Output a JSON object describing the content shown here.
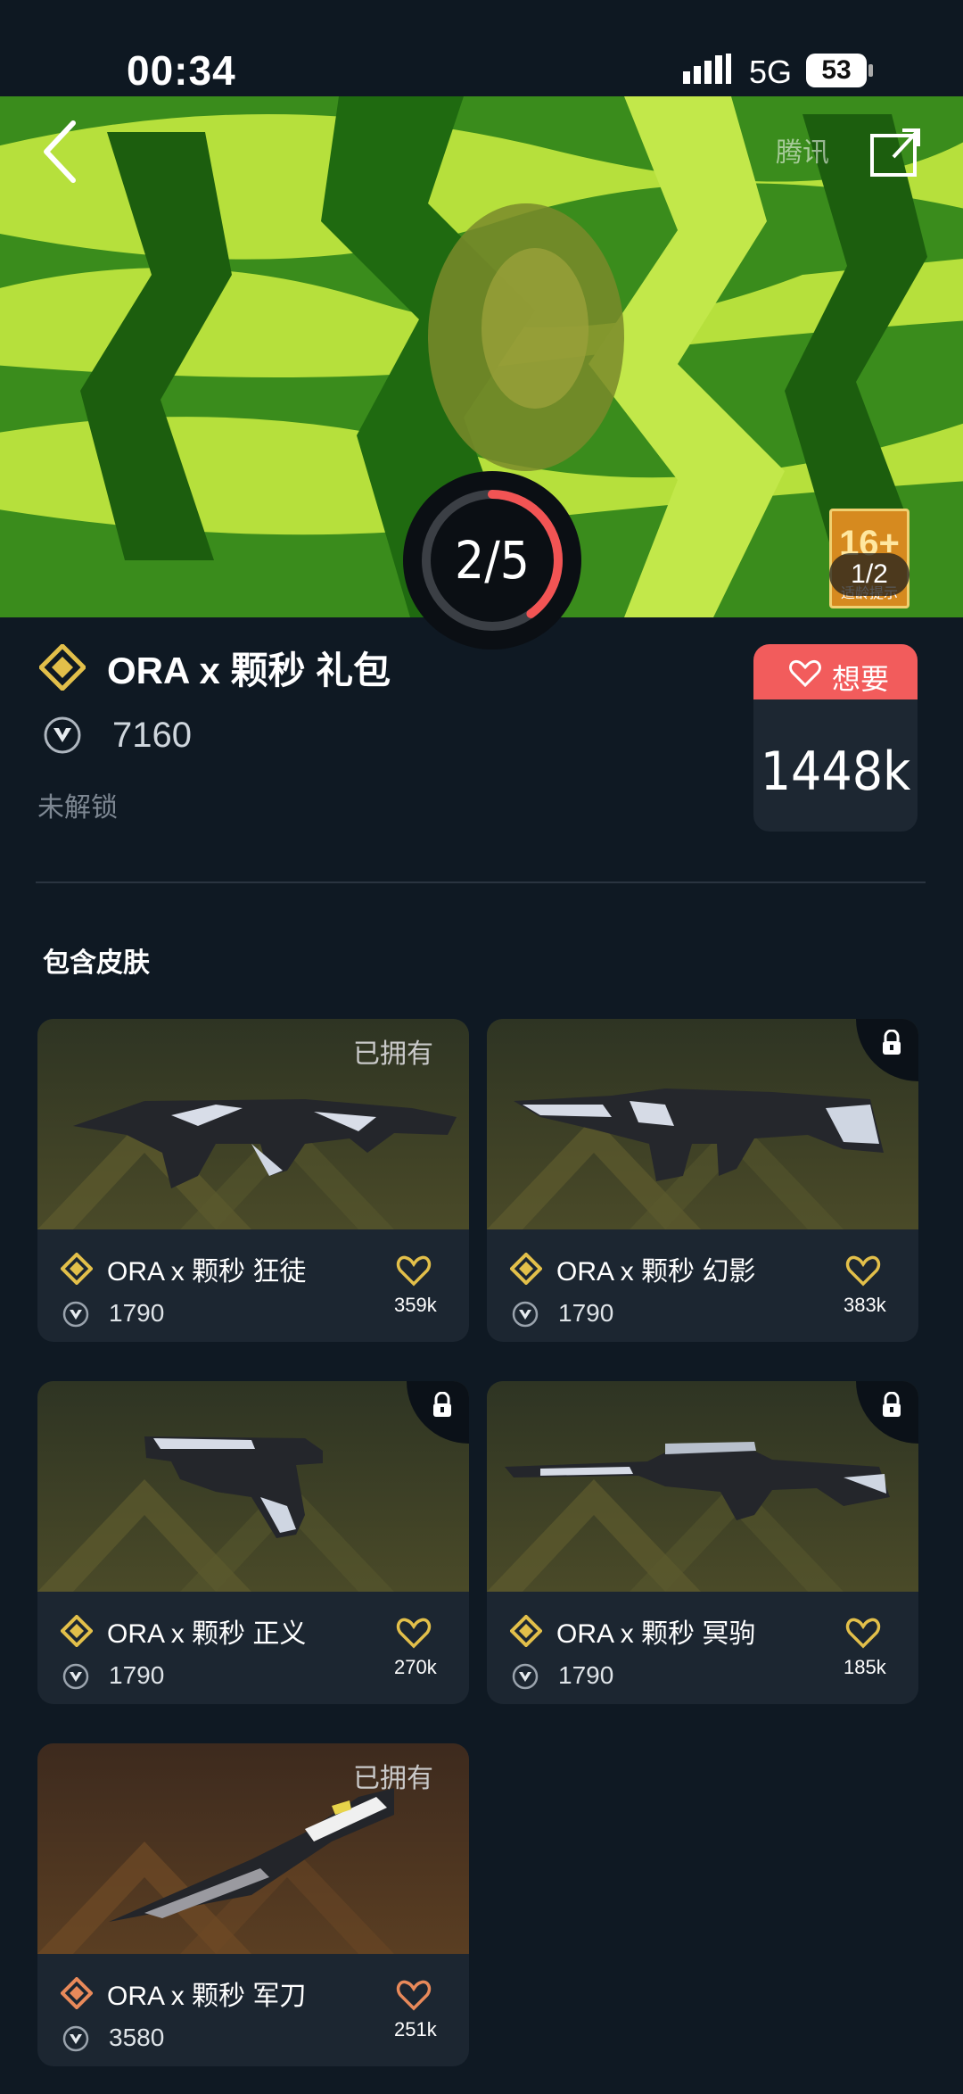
{
  "status_bar": {
    "time": "00:34",
    "network": "5G",
    "battery": "53"
  },
  "hero": {
    "watermark": "腾讯",
    "progress_text": "2/5",
    "progress_fraction": 0.4,
    "age_badge_top": "16+",
    "age_badge_bottom": "适龄提示",
    "image_page": "1/2"
  },
  "bundle": {
    "title": "ORA x 颗秒 礼包",
    "price": "7160",
    "unlock_state": "未解锁",
    "want_label": "想要",
    "want_count": "1448k"
  },
  "section_title": "包含皮肤",
  "skins": [
    {
      "name": "ORA x 颗秒 狂徒",
      "price": "1790",
      "likes": "359k",
      "owned_label": "已拥有",
      "locked": false,
      "tier_color": "#e2bf4a",
      "weapon": "rifle"
    },
    {
      "name": "ORA x 颗秒 幻影",
      "price": "1790",
      "likes": "383k",
      "owned_label": "",
      "locked": true,
      "tier_color": "#e2bf4a",
      "weapon": "rifle2"
    },
    {
      "name": "ORA x 颗秒 正义",
      "price": "1790",
      "likes": "270k",
      "owned_label": "",
      "locked": true,
      "tier_color": "#e2bf4a",
      "weapon": "pistol"
    },
    {
      "name": "ORA x 颗秒 冥驹",
      "price": "1790",
      "likes": "185k",
      "owned_label": "",
      "locked": true,
      "tier_color": "#e2bf4a",
      "weapon": "sniper"
    },
    {
      "name": "ORA x 颗秒 军刀",
      "price": "3580",
      "likes": "251k",
      "owned_label": "已拥有",
      "locked": false,
      "tier_color": "#e8895a",
      "weapon": "knife"
    }
  ],
  "colors": {
    "background": "#0f1923",
    "card": "#1c2631",
    "accent_red": "#f25c5c",
    "gold": "#e2bf4a"
  }
}
